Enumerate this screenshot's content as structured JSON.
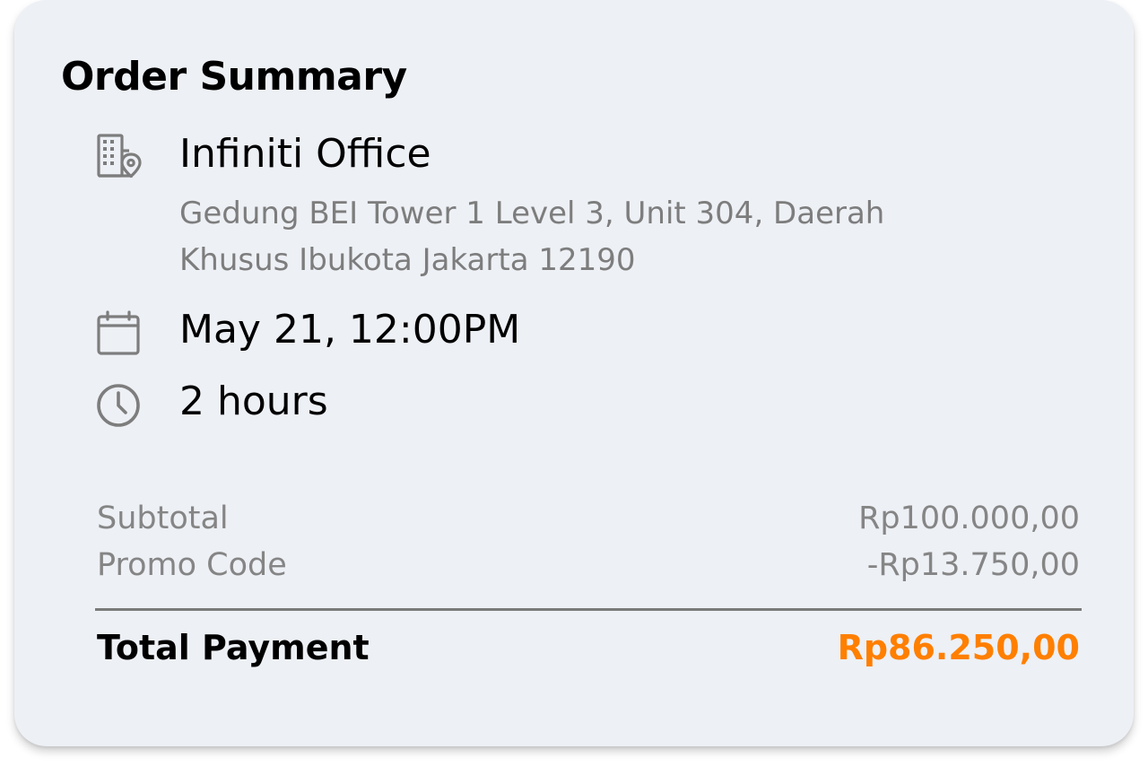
{
  "order_summary": {
    "title": "Order Summary",
    "venue": {
      "icon": "building-location-icon",
      "name": "Infiniti Office",
      "address": "Gedung BEI Tower 1 Level 3, Unit 304, Daerah Khusus Ibukota Jakarta 12190"
    },
    "date": {
      "icon": "calendar-icon",
      "value": "May 21, 12:00PM"
    },
    "duration": {
      "icon": "clock-icon",
      "value": "2 hours"
    },
    "subtotal": {
      "label": "Subtotal",
      "value": "Rp100.000,00"
    },
    "promo": {
      "label": "Promo Code",
      "value": "-Rp13.750,00"
    },
    "total": {
      "label": "Total Payment",
      "value": "Rp86.250,00"
    }
  },
  "colors": {
    "card_background": "#edf0f5",
    "muted_text": "#858585",
    "total_accent": "#ff7f00",
    "icon": "#7d7d7d"
  }
}
